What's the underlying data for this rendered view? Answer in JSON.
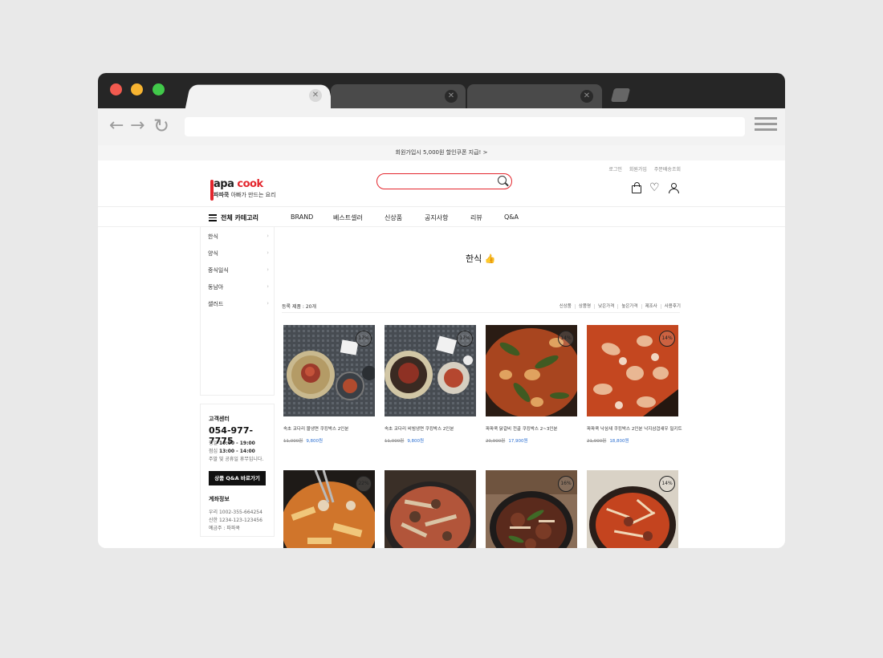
{
  "colors": {
    "accent": "#e3262d",
    "sale_price": "#2a6ed1",
    "dark": "#111111"
  },
  "notice": "회원가입시 5,000원 할인쿠폰 지급! >",
  "top_links": [
    "로그인",
    "회원가입",
    "주문배송조회"
  ],
  "logo": {
    "main_left": "apa ",
    "main_accent": "cook",
    "sub_bold": "파파쿡",
    "sub": "아빠가 만드는 요리"
  },
  "all_category": "전체 카테고리",
  "gnb": [
    "BRAND",
    "베스트셀러",
    "신상품",
    "공지사항",
    "리뷰",
    "Q&A"
  ],
  "sidebar": [
    "한식",
    "양식",
    "중식일식",
    "동남아",
    "샐러드"
  ],
  "customer_service": {
    "title": "고객센터",
    "phone": "054-977-7775",
    "hours_weekday_label": "평일",
    "hours_weekday": "10:00 - 19:00",
    "hours_lunch_label": "점심",
    "hours_lunch": "13:00 - 14:00",
    "closed": "주말 및 공휴일 휴무입니다.",
    "qa_button": "상품 Q&A 바로가기",
    "bank_title": "계좌정보",
    "bank1": "우리 1002-355-664254",
    "bank2": "신한 1234-123-123456",
    "holder": "예금주 : 파파쿡"
  },
  "category_title": "한식 👍",
  "count_text": "등록 제품 : 20개",
  "sort_options": [
    "신상품",
    "상품명",
    "낮은가격",
    "높은가격",
    "제조사",
    "사용후기"
  ],
  "products": [
    {
      "name": "속초 코다리 물냉면 쿠킹박스 2인분",
      "old_price": "11,000원",
      "price": "9,800원",
      "badge": "17%",
      "image": "noodle-dish-cold"
    },
    {
      "name": "속초 코다리 비빔냉면 쿠킹박스 2인분",
      "old_price": "11,000원",
      "price": "9,800원",
      "badge": "17%",
      "image": "noodle-dish-cold"
    },
    {
      "name": "파파쿡 닭갈비 전골 쿠킹박스 2~3인분",
      "old_price": "20,900원",
      "price": "17,900원",
      "badge": "14%",
      "image": "stew-hotpot"
    },
    {
      "name": "파파쿡 낙삼새 쿠킹박스 2인분 낙지삼겹새우 밀키트",
      "old_price": "21,900원",
      "price": "18,800원",
      "badge": "14%",
      "image": "seafood-stew"
    },
    {
      "name": "",
      "old_price": "",
      "price": "",
      "badge": "22%",
      "image": "budae-stew"
    },
    {
      "name": "",
      "old_price": "",
      "price": "",
      "badge": "",
      "image": "mushroom-stew"
    },
    {
      "name": "",
      "old_price": "",
      "price": "",
      "badge": "16%",
      "image": "bulgogi-hotpot"
    },
    {
      "name": "",
      "old_price": "",
      "price": "",
      "badge": "14%",
      "image": "spicy-stew"
    }
  ]
}
